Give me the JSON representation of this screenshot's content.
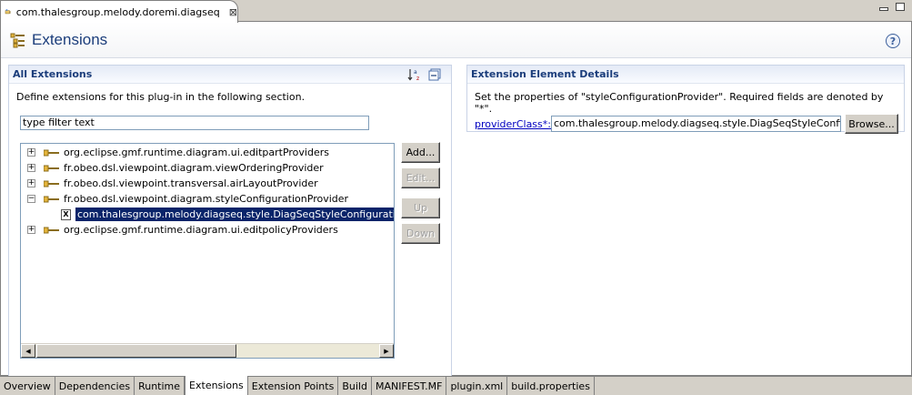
{
  "editor": {
    "tab_title": "com.thalesgroup.melody.doremi.diagseq",
    "tab_close": "⊠"
  },
  "header": {
    "title": "Extensions",
    "help": "?"
  },
  "all_extensions": {
    "title": "All Extensions",
    "description": "Define extensions for this plug-in in the following section.",
    "filter_value": "type filter text",
    "sort_icon_text": "a↓z",
    "tree": [
      {
        "label": "org.eclipse.gmf.runtime.diagram.ui.editpartProviders",
        "expander": "+"
      },
      {
        "label": "fr.obeo.dsl.viewpoint.diagram.viewOrderingProvider",
        "expander": "+"
      },
      {
        "label": "fr.obeo.dsl.viewpoint.transversal.airLayoutProvider",
        "expander": "+"
      },
      {
        "label": "fr.obeo.dsl.viewpoint.diagram.styleConfigurationProvider",
        "expander": "−"
      },
      {
        "label": "com.thalesgroup.melody.diagseq.style.DiagSeqStyleConfigurationProvid",
        "leaf_icon": "X"
      },
      {
        "label": "org.eclipse.gmf.runtime.diagram.ui.editpolicyProviders",
        "expander": "+"
      }
    ],
    "buttons": {
      "add": "Add...",
      "edit": "Edit...",
      "up": "Up",
      "down": "Down"
    }
  },
  "details": {
    "title": "Extension Element Details",
    "description": "Set the properties of \"styleConfigurationProvider\". Required fields are denoted by \"*\".",
    "field_label": "providerClass*:",
    "field_value": "com.thalesgroup.melody.diagseq.style.DiagSeqStyleConfigurationProvider",
    "browse": "Browse..."
  },
  "bottom_tabs": [
    {
      "label": "Overview"
    },
    {
      "label": "Dependencies"
    },
    {
      "label": "Runtime"
    },
    {
      "label": "Extensions",
      "active": true
    },
    {
      "label": "Extension Points"
    },
    {
      "label": "Build"
    },
    {
      "label": "MANIFEST.MF"
    },
    {
      "label": "plugin.xml"
    },
    {
      "label": "build.properties"
    }
  ],
  "colors": {
    "title": "#1b3d7b",
    "selection": "#0a246a",
    "link": "#0000c0"
  }
}
